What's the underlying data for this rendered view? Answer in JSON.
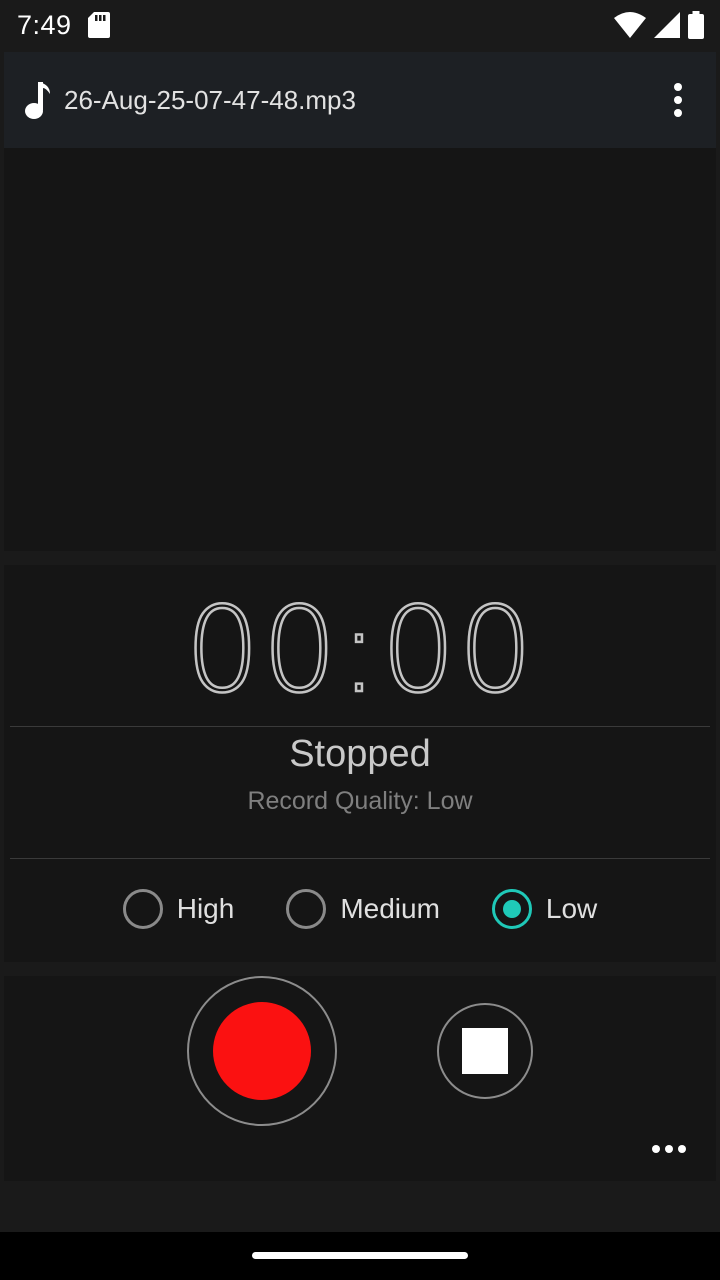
{
  "status_bar": {
    "time": "7:49",
    "icons": [
      "sd-card-icon",
      "wifi-icon",
      "signal-icon",
      "battery-icon"
    ]
  },
  "file_header": {
    "icon": "music-note-icon",
    "file_name": "26-Aug-25-07-47-48.mp3",
    "menu_icon": "more-vert-icon"
  },
  "recorder": {
    "timer": "00:00",
    "state": "Stopped",
    "quality_text": "Record Quality: Low",
    "quality_options": [
      {
        "label": "High",
        "selected": false
      },
      {
        "label": "Medium",
        "selected": false
      },
      {
        "label": "Low",
        "selected": true
      }
    ]
  },
  "controls": {
    "record_icon": "record-icon",
    "stop_icon": "stop-icon",
    "more_icon": "more-horiz-icon"
  },
  "colors": {
    "accent": "#1fc9b8",
    "record": "#fb1111",
    "background": "#1a1a1a",
    "panel": "#151515",
    "header": "#1d2024"
  }
}
